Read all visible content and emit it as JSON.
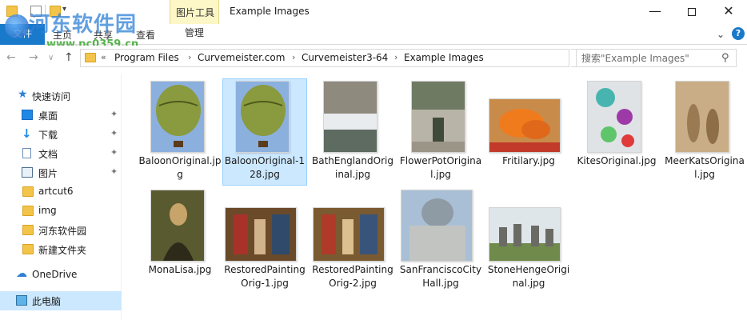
{
  "window": {
    "title": "Example Images",
    "tools_tab": "图片工具",
    "manage_tab": "管理"
  },
  "watermark": {
    "title": "河东软件园",
    "url": "www.pc0359.cn"
  },
  "ribbon": {
    "tabs": [
      {
        "label": "文件"
      },
      {
        "label": "主页"
      },
      {
        "label": "共享"
      },
      {
        "label": "查看"
      }
    ]
  },
  "address": {
    "prefix": "«",
    "crumbs": [
      "Program Files",
      "Curvemeister.com",
      "Curvemeister3-64",
      "Example Images"
    ],
    "search_placeholder": "搜索\"Example Images\""
  },
  "sidebar": {
    "items": [
      {
        "label": "快速访问",
        "icon": "star-icon",
        "pinned": false
      },
      {
        "label": "桌面",
        "icon": "desktop-icon",
        "pinned": true
      },
      {
        "label": "下载",
        "icon": "download-icon",
        "pinned": true
      },
      {
        "label": "文档",
        "icon": "document-icon",
        "pinned": true
      },
      {
        "label": "图片",
        "icon": "pictures-icon",
        "pinned": true
      },
      {
        "label": "artcut6",
        "icon": "folder-icon",
        "pinned": false
      },
      {
        "label": "img",
        "icon": "folder-icon",
        "pinned": false
      },
      {
        "label": "河东软件园",
        "icon": "folder-icon",
        "pinned": false
      },
      {
        "label": "新建文件夹",
        "icon": "folder-icon",
        "pinned": false
      },
      {
        "label": "OneDrive",
        "icon": "onedrive-icon",
        "pinned": false
      },
      {
        "label": "此电脑",
        "icon": "this-pc-icon",
        "pinned": false,
        "selected": true
      }
    ]
  },
  "files": [
    {
      "name": "BaloonOriginal.jpg",
      "thumb": "balloon-thumbnail"
    },
    {
      "name": "BaloonOriginal-128.jpg",
      "thumb": "balloon-thumbnail",
      "selected": true
    },
    {
      "name": "BathEnglandOriginal.jpg",
      "thumb": "bath-thumbnail"
    },
    {
      "name": "FlowerPotOriginal.jpg",
      "thumb": "flowerpot-thumbnail"
    },
    {
      "name": "Fritilary.jpg",
      "thumb": "butterfly-thumbnail"
    },
    {
      "name": "KitesOriginal.jpg",
      "thumb": "kites-thumbnail"
    },
    {
      "name": "MeerKatsOriginal.jpg",
      "thumb": "meerkats-thumbnail"
    },
    {
      "name": "MonaLisa.jpg",
      "thumb": "monalisa-thumbnail"
    },
    {
      "name": "RestoredPaintingOrig-1.jpg",
      "thumb": "painting-thumbnail"
    },
    {
      "name": "RestoredPaintingOrig-2.jpg",
      "thumb": "painting-thumbnail"
    },
    {
      "name": "SanFranciscoCityHall.jpg",
      "thumb": "cityhall-thumbnail"
    },
    {
      "name": "StoneHengeOriginal.jpg",
      "thumb": "stonehenge-thumbnail"
    }
  ]
}
